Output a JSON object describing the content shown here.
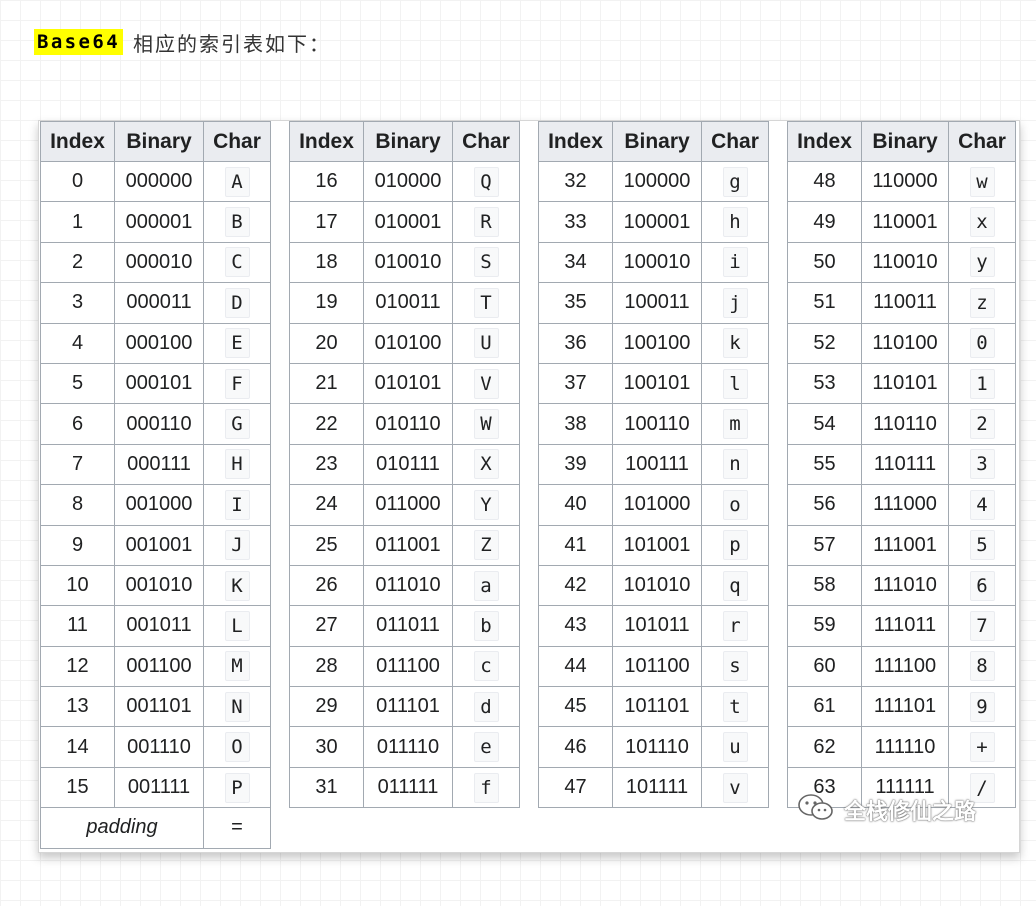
{
  "heading": {
    "highlight": "Base64",
    "text": "相应的索引表如下："
  },
  "table": {
    "headers": [
      "Index",
      "Binary",
      "Char"
    ],
    "blocks": [
      {
        "rows": [
          [
            "0",
            "000000",
            "A"
          ],
          [
            "1",
            "000001",
            "B"
          ],
          [
            "2",
            "000010",
            "C"
          ],
          [
            "3",
            "000011",
            "D"
          ],
          [
            "4",
            "000100",
            "E"
          ],
          [
            "5",
            "000101",
            "F"
          ],
          [
            "6",
            "000110",
            "G"
          ],
          [
            "7",
            "000111",
            "H"
          ],
          [
            "8",
            "001000",
            "I"
          ],
          [
            "9",
            "001001",
            "J"
          ],
          [
            "10",
            "001010",
            "K"
          ],
          [
            "11",
            "001011",
            "L"
          ],
          [
            "12",
            "001100",
            "M"
          ],
          [
            "13",
            "001101",
            "N"
          ],
          [
            "14",
            "001110",
            "O"
          ],
          [
            "15",
            "001111",
            "P"
          ]
        ]
      },
      {
        "rows": [
          [
            "16",
            "010000",
            "Q"
          ],
          [
            "17",
            "010001",
            "R"
          ],
          [
            "18",
            "010010",
            "S"
          ],
          [
            "19",
            "010011",
            "T"
          ],
          [
            "20",
            "010100",
            "U"
          ],
          [
            "21",
            "010101",
            "V"
          ],
          [
            "22",
            "010110",
            "W"
          ],
          [
            "23",
            "010111",
            "X"
          ],
          [
            "24",
            "011000",
            "Y"
          ],
          [
            "25",
            "011001",
            "Z"
          ],
          [
            "26",
            "011010",
            "a"
          ],
          [
            "27",
            "011011",
            "b"
          ],
          [
            "28",
            "011100",
            "c"
          ],
          [
            "29",
            "011101",
            "d"
          ],
          [
            "30",
            "011110",
            "e"
          ],
          [
            "31",
            "011111",
            "f"
          ]
        ]
      },
      {
        "rows": [
          [
            "32",
            "100000",
            "g"
          ],
          [
            "33",
            "100001",
            "h"
          ],
          [
            "34",
            "100010",
            "i"
          ],
          [
            "35",
            "100011",
            "j"
          ],
          [
            "36",
            "100100",
            "k"
          ],
          [
            "37",
            "100101",
            "l"
          ],
          [
            "38",
            "100110",
            "m"
          ],
          [
            "39",
            "100111",
            "n"
          ],
          [
            "40",
            "101000",
            "o"
          ],
          [
            "41",
            "101001",
            "p"
          ],
          [
            "42",
            "101010",
            "q"
          ],
          [
            "43",
            "101011",
            "r"
          ],
          [
            "44",
            "101100",
            "s"
          ],
          [
            "45",
            "101101",
            "t"
          ],
          [
            "46",
            "101110",
            "u"
          ],
          [
            "47",
            "101111",
            "v"
          ]
        ]
      },
      {
        "rows": [
          [
            "48",
            "110000",
            "w"
          ],
          [
            "49",
            "110001",
            "x"
          ],
          [
            "50",
            "110010",
            "y"
          ],
          [
            "51",
            "110011",
            "z"
          ],
          [
            "52",
            "110100",
            "0"
          ],
          [
            "53",
            "110101",
            "1"
          ],
          [
            "54",
            "110110",
            "2"
          ],
          [
            "55",
            "110111",
            "3"
          ],
          [
            "56",
            "111000",
            "4"
          ],
          [
            "57",
            "111001",
            "5"
          ],
          [
            "58",
            "111010",
            "6"
          ],
          [
            "59",
            "111011",
            "7"
          ],
          [
            "60",
            "111100",
            "8"
          ],
          [
            "61",
            "111101",
            "9"
          ],
          [
            "62",
            "111110",
            "+"
          ],
          [
            "63",
            "111111",
            "/"
          ]
        ]
      }
    ],
    "padding": {
      "label": "padding",
      "char": "="
    }
  },
  "watermark": {
    "icon": "wechat-icon",
    "text": "全栈修仙之路"
  }
}
